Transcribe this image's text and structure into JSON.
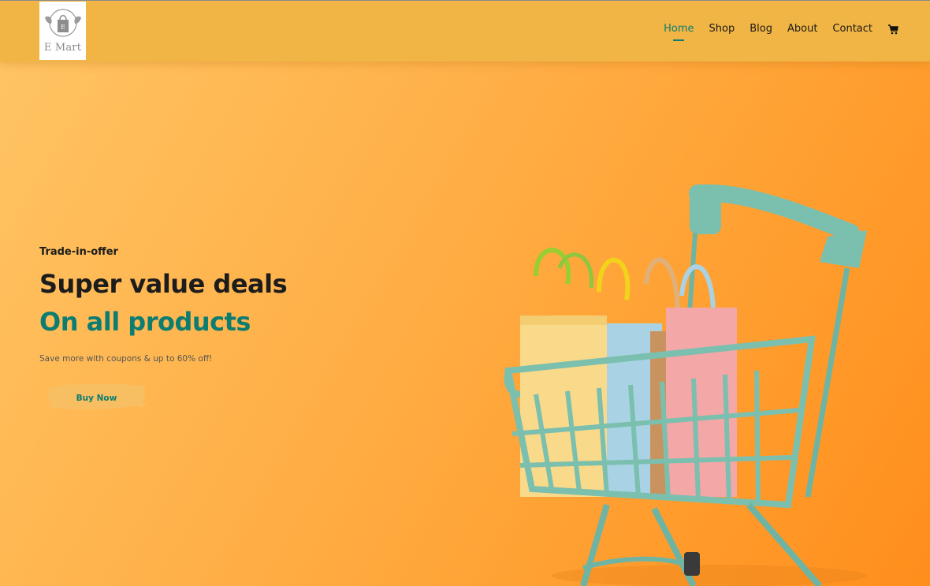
{
  "brand": {
    "name": "E Mart",
    "logo_icon": "shopping-bag-wings-icon"
  },
  "nav": {
    "items": [
      {
        "label": "Home",
        "active": true
      },
      {
        "label": "Shop",
        "active": false
      },
      {
        "label": "Blog",
        "active": false
      },
      {
        "label": "About",
        "active": false
      },
      {
        "label": "Contact",
        "active": false
      }
    ],
    "cart_icon": "cart-icon"
  },
  "hero": {
    "eyebrow": "Trade-in-offer",
    "headline": "Super value deals",
    "headline_highlight": "On all products",
    "subtext": "Save more with coupons & up to 60% off!",
    "cta_label": "Buy Now",
    "image": "shopping-cart-with-bags-photo"
  },
  "colors": {
    "topbar": "#f1b545",
    "accent": "#0c7d70",
    "background": "#ffae45",
    "cart": "#7bbfae"
  }
}
